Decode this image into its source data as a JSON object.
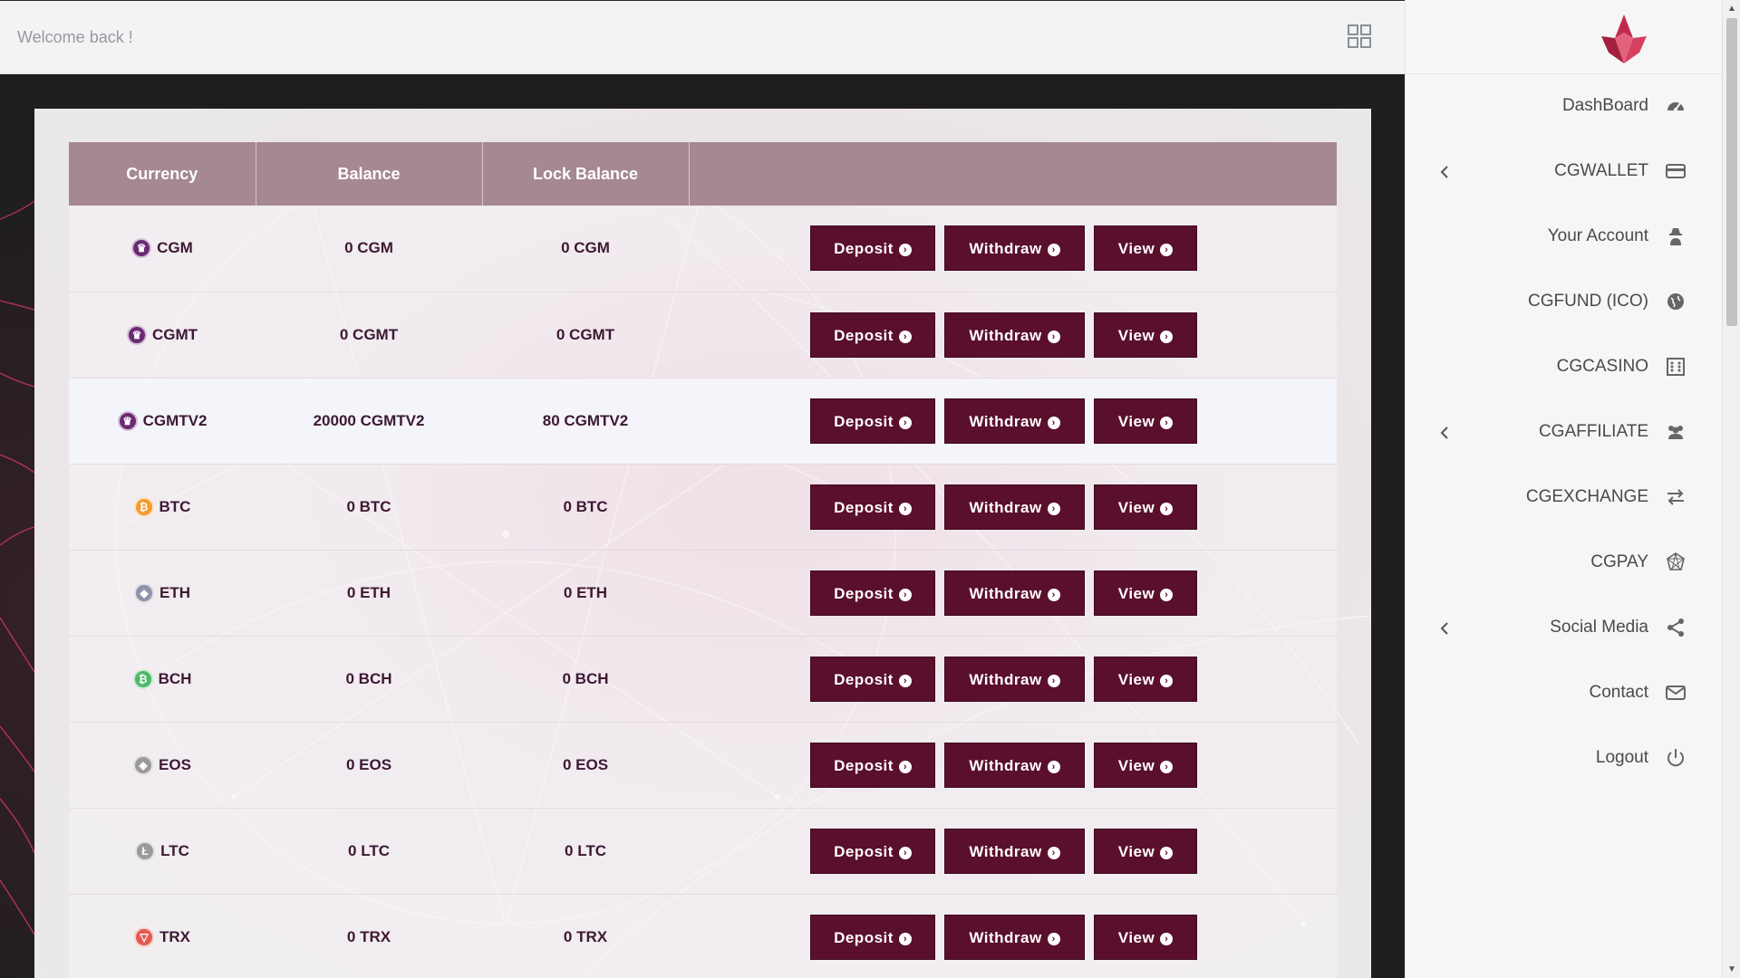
{
  "header": {
    "welcome": "Welcome back !",
    "grid_icon": "grid-icon"
  },
  "table": {
    "headers": [
      "Currency",
      "Balance",
      "Lock Balance",
      ""
    ],
    "rows": [
      {
        "currency": "CGM",
        "balance": "0 CGM",
        "lock": "0 CGM",
        "icon_color": "#6b2a73",
        "glyph": "♛",
        "highlight": false
      },
      {
        "currency": "CGMT",
        "balance": "0 CGMT",
        "lock": "0 CGMT",
        "icon_color": "#6b2a73",
        "glyph": "♛",
        "highlight": false
      },
      {
        "currency": "CGMTV2",
        "balance": "20000 CGMTV2",
        "lock": "80 CGMTV2",
        "icon_color": "#6b2a73",
        "glyph": "♛",
        "highlight": true
      },
      {
        "currency": "BTC",
        "balance": "0 BTC",
        "lock": "0 BTC",
        "icon_color": "#f29a2e",
        "glyph": "₿",
        "highlight": false
      },
      {
        "currency": "ETH",
        "balance": "0 ETH",
        "lock": "0 ETH",
        "icon_color": "#8c93ab",
        "glyph": "◆",
        "highlight": false
      },
      {
        "currency": "BCH",
        "balance": "0 BCH",
        "lock": "0 BCH",
        "icon_color": "#4cb868",
        "glyph": "₿",
        "highlight": false
      },
      {
        "currency": "EOS",
        "balance": "0 EOS",
        "lock": "0 EOS",
        "icon_color": "#9a9a9a",
        "glyph": "◈",
        "highlight": false
      },
      {
        "currency": "LTC",
        "balance": "0 LTC",
        "lock": "0 LTC",
        "icon_color": "#9b9b9b",
        "glyph": "Ł",
        "highlight": false
      },
      {
        "currency": "TRX",
        "balance": "0 TRX",
        "lock": "0 TRX",
        "icon_color": "#e35a52",
        "glyph": "▽",
        "highlight": false
      }
    ],
    "buttons": {
      "deposit": "Deposit",
      "withdraw": "Withdraw",
      "view": "View"
    }
  },
  "sidebar": {
    "items": [
      {
        "label": "DashBoard",
        "icon": "dashboard-icon",
        "chevron": false
      },
      {
        "label": "CGWALLET",
        "icon": "credit-card-icon",
        "chevron": true
      },
      {
        "label": "Your Account",
        "icon": "user-secret-icon",
        "chevron": false
      },
      {
        "label": "CGFUND (ICO)",
        "icon": "globe-icon",
        "chevron": false
      },
      {
        "label": "CGCASINO",
        "icon": "dice-icon",
        "chevron": false
      },
      {
        "label": "CGAFFILIATE",
        "icon": "users-icon",
        "chevron": true
      },
      {
        "label": "CGEXCHANGE",
        "icon": "exchange-icon",
        "chevron": false
      },
      {
        "label": "CGPAY",
        "icon": "gem-icon",
        "chevron": false
      },
      {
        "label": "Social Media",
        "icon": "share-icon",
        "chevron": true
      },
      {
        "label": "Contact",
        "icon": "envelope-icon",
        "chevron": false
      },
      {
        "label": "Logout",
        "icon": "power-icon",
        "chevron": false
      }
    ]
  },
  "colors": {
    "button": "#5a0f2c",
    "table_header": "#a58891",
    "accent": "#c0294e"
  }
}
